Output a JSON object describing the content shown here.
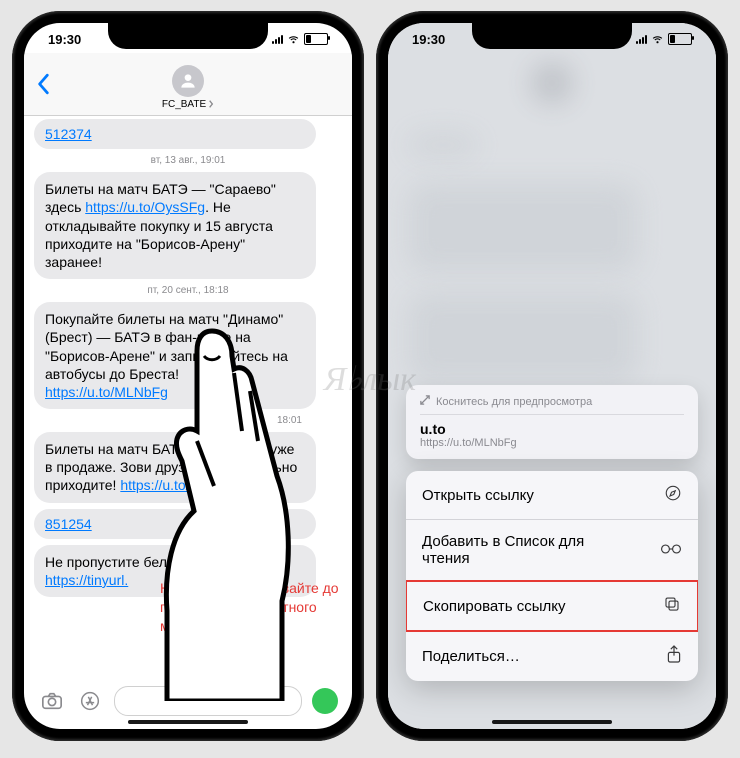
{
  "status": {
    "time": "19:30"
  },
  "left": {
    "contact_name": "FC_BATE",
    "link_bubble_1": "512374",
    "ts1": "вт, 13 авг., 19:01",
    "msg1_pre": "Билеты на матч БАТЭ — \"Сараево\" здесь ",
    "msg1_link": "https://u.to/OysSFg",
    "msg1_post": ". Не откладывайте покупку и 15 августа приходите на \"Борисов-Арену\" заранее!",
    "ts2": "пт, 20 сент., 18:18",
    "msg2_pre": "Покупайте билеты на матч \"Динамо\" (Брест) — БАТЭ в фан-шопе на \"Борисов-Арене\" и записывайтесь на автобусы до Бреста! ",
    "msg2_link": "https://u.to/MLNbFg",
    "ts3": "18:01",
    "msg3_pre": "Билеты на матч БАТЭ — \"Гомель\" уже в продаже. Зови друзей и обязательно приходите! ",
    "msg3_link": "https://u.to/r6d9Fg",
    "link_bubble_2": "851254",
    "msg4_pre": "Не пропустите белорусское \"",
    "msg4_link": "https://tinyurl."
  },
  "callout": "Нажмите и удерживайте до появления контекстного меню",
  "right": {
    "preview_hint": "Коснитесь для предпросмотра",
    "preview_title": "u.to",
    "preview_url": "https://u.to/MLNbFg",
    "menu": {
      "open": "Открыть ссылку",
      "reading_list": "Добавить в Список для чтения",
      "copy": "Скопировать ссылку",
      "share": "Поделиться…"
    }
  },
  "watermark": "Я♭лык"
}
